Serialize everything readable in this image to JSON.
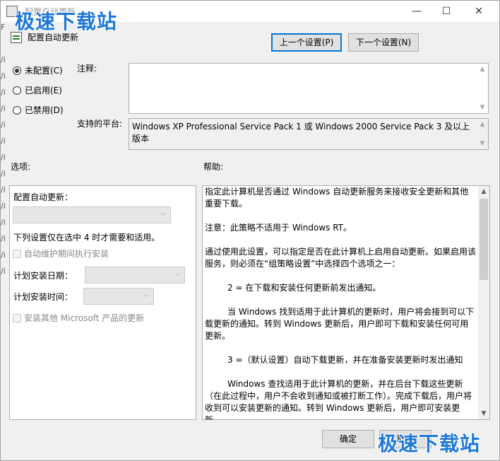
{
  "window": {
    "title": "配置自动更新",
    "controls": {
      "min": "—",
      "max": "☐",
      "close": "✕"
    }
  },
  "watermark": {
    "text": "极速下载站"
  },
  "strip": [
    "F",
    "/i",
    "/i",
    "/i",
    "/i",
    "/i",
    "/i",
    "/i",
    "/i",
    "/i",
    "/i",
    "/i",
    "/i",
    "/i",
    "/i"
  ],
  "header": {
    "title": "配置自动更新"
  },
  "nav": {
    "prev": "上一个设置(P)",
    "next": "下一个设置(N)"
  },
  "state": {
    "options": [
      {
        "label": "未配置(C)",
        "selected": true
      },
      {
        "label": "已启用(E)",
        "selected": false
      },
      {
        "label": "已禁用(D)",
        "selected": false
      }
    ]
  },
  "labels": {
    "comment": "注释:",
    "platform": "支持的平台:",
    "options": "选项:",
    "help": "帮助:"
  },
  "platform_text": "Windows XP Professional Service Pack 1 或 Windows 2000 Service Pack 3 及以上版本",
  "options_panel": {
    "title": "配置自动更新：",
    "note": "下列设置仅在选中 4 时才需要和适用。",
    "auto_maintain": "自动维护期间执行安装",
    "install_day": "计划安装日期：",
    "install_time": "计划安装时间：",
    "other_products": "安装其他 Microsoft 产品的更新"
  },
  "help": {
    "paragraphs": [
      "指定此计算机是否通过 Windows 自动更新服务来接收安全更新和其他重要下载。",
      "注意：此策略不适用于 Windows RT。",
      "通过使用此设置，可以指定是否在此计算机上启用自动更新。如果启用该服务，则必须在“组策略设置”中选择四个选项之一：",
      "2 = 在下载和安装任何更新前发出通知。",
      "当 Windows 找到适用于此计算机的更新时，用户将会接到可以下载更新的通知。转到 Windows 更新后，用户即可下载和安装任何可用更新。",
      "3 =（默认设置）自动下载更新，并在准备安装更新时发出通知",
      "Windows 查找适用于此计算机的更新，并在后台下载这些更新（在此过程中，用户不会收到通知或被打断工作）。完成下载后，用户将收到可以安装更新的通知。转到 Windows 更新后，用户即可安装更新。"
    ]
  },
  "footer": {
    "ok": "确定",
    "cancel": "取消"
  }
}
